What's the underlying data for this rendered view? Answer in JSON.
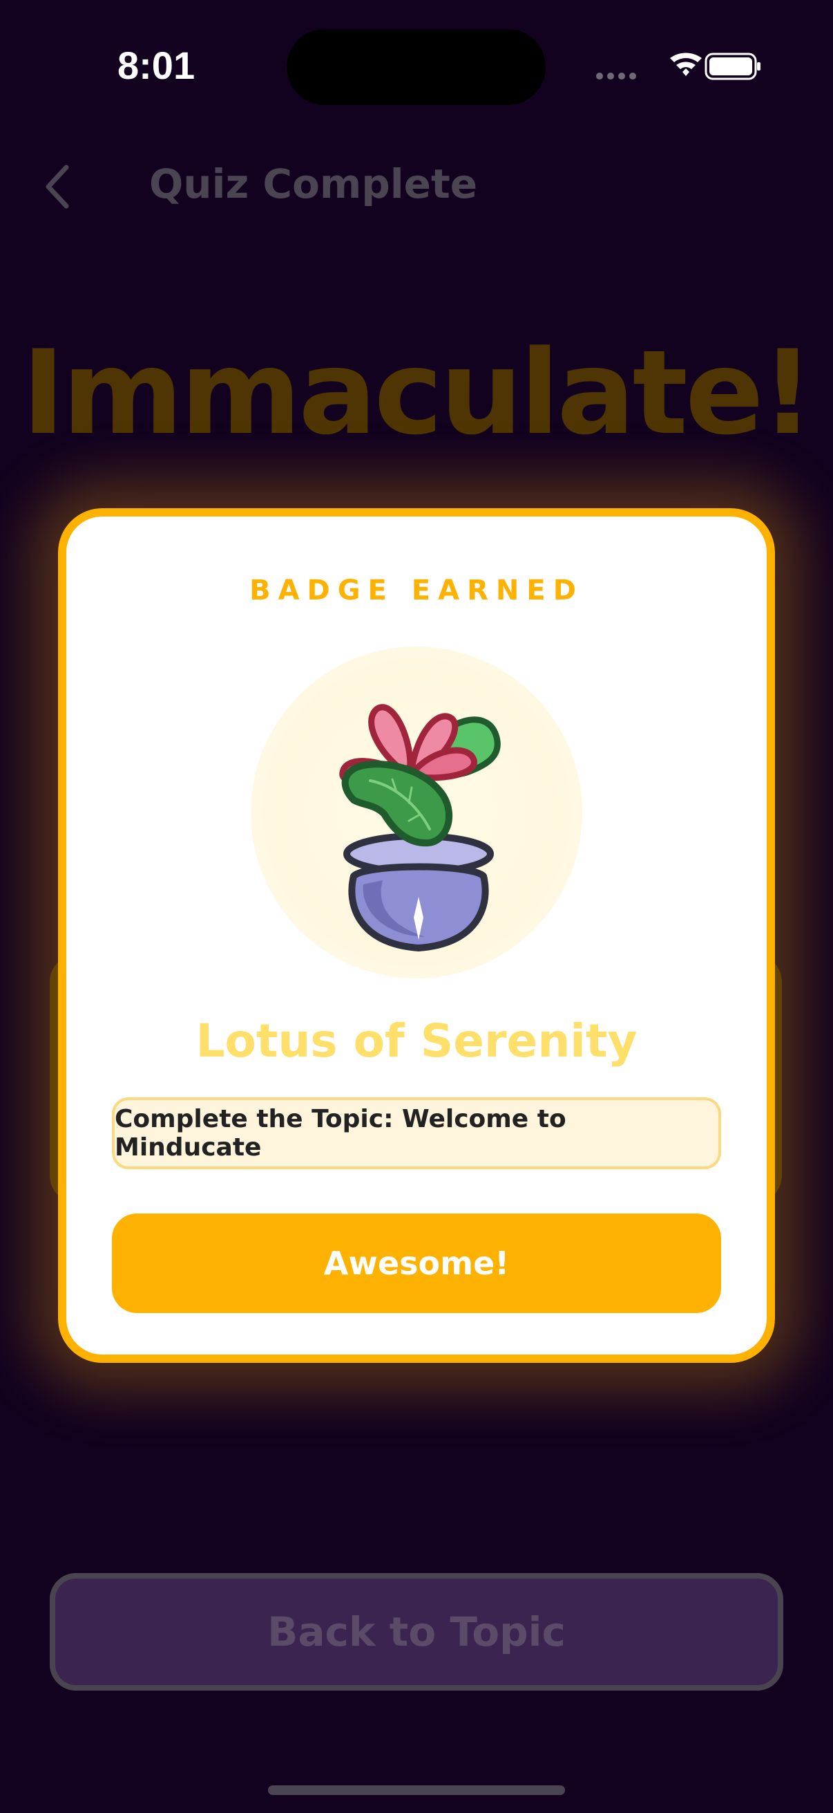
{
  "status_bar": {
    "time": "8:01",
    "icons": [
      "signal-dots-icon",
      "wifi-icon",
      "battery-icon"
    ]
  },
  "nav": {
    "back_icon": "chevron-left-icon",
    "title": "Quiz Complete"
  },
  "hero": {
    "title": "Immaculate!"
  },
  "modal": {
    "eyebrow": "BADGE EARNED",
    "badge_icon": "lotus-pot-icon",
    "badge_name": "Lotus of Serenity",
    "requirement": "Complete the Topic: Welcome to Minducate",
    "confirm_label": "Awesome!"
  },
  "footer": {
    "back_label": "Back to Topic"
  },
  "colors": {
    "accent": "#fdb202",
    "background": "#12021f",
    "badge_name": "#fddf6a"
  }
}
